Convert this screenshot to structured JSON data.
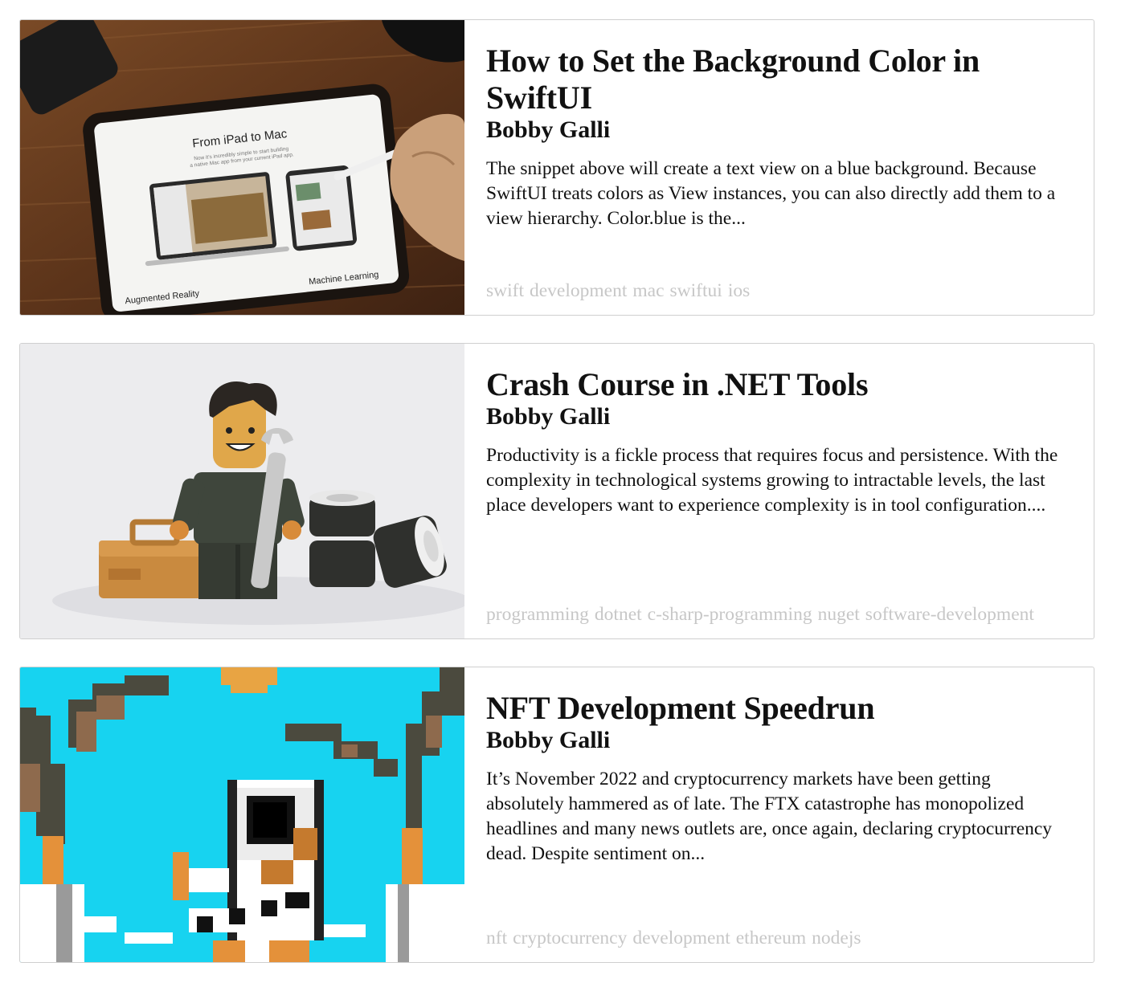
{
  "articles": [
    {
      "title": "How to Set the Background Color in SwiftUI",
      "author": "Bobby Galli",
      "excerpt": "The snippet above will create a text view on a blue background. Because SwiftUI treats colors as View instances, you can also directly add them to a view hierarchy. Color.blue is the...",
      "tags": [
        "swift",
        "development",
        "mac",
        "swiftui",
        "ios"
      ],
      "image": {
        "icon": "ipad-on-desk-image",
        "screen_heading": "From iPad to Mac",
        "screen_subtext_1": "Now it’s incredibly simple to start building",
        "screen_subtext_2": "a native Mac app from your current iPad app.",
        "label_left": "Augmented Reality",
        "label_right": "Machine Learning"
      }
    },
    {
      "title": "Crash Course in .NET Tools",
      "author": "Bobby Galli",
      "excerpt": "Productivity is a fickle process that requires focus and persistence. With the complexity in technological systems growing to intractable levels, the last place developers want to experience complexity is in tool configuration....",
      "tags": [
        "programming",
        "dotnet",
        "c-sharp-programming",
        "nuget",
        "software-development"
      ],
      "image": {
        "icon": "lego-mechanic-image"
      }
    },
    {
      "title": "NFT Development Speedrun",
      "author": "Bobby Galli",
      "excerpt": "It’s November 2022 and cryptocurrency markets have been getting absolutely hammered as of late. The FTX catastrophe has monopolized headlines and many news outlets are, once again, declaring cryptocurrency dead. Despite sentiment on...",
      "tags": [
        "nft",
        "cryptocurrency",
        "development",
        "ethereum",
        "nodejs"
      ],
      "image": {
        "icon": "pixel-art-astronaut-image"
      }
    }
  ]
}
